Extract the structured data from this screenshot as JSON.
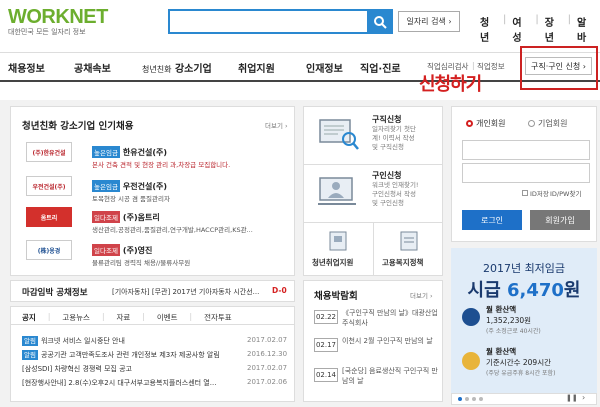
{
  "header": {
    "logo_text": "WORKNET",
    "logo_sub": "대한민국 모든 일자리 정보",
    "search_placeholder": "",
    "job_search_label": "일자리 검색",
    "top_links": [
      "청년",
      "여성",
      "장년",
      "알바"
    ]
  },
  "nav": {
    "items": [
      "채용정보",
      "공채속보",
      "청년친화",
      "강소기업",
      "취업지원",
      "인재정보",
      "직업·진로"
    ],
    "sub_items": [
      "직업심리검사",
      "직업정보"
    ],
    "apply_button": "구직·구인 신청"
  },
  "annotation": "신청하기",
  "companies_section": {
    "title": "청년친화 강소기업 인기채용",
    "more": "더보기",
    "items": [
      {
        "logo": "(주)한유건설",
        "tag": "높은임금",
        "tag_color": "#2a88d0",
        "name": "한유건설(주)",
        "desc": "본사 건축 견적 및 현장 관리 과,차장급 모집합니다."
      },
      {
        "logo": "우전건설(주)",
        "tag": "높은임금",
        "tag_color": "#2a88d0",
        "name": "우전건설(주)",
        "desc": "토목현장 시공 겸 품질관리자"
      },
      {
        "logo": "옴트리",
        "tag": "일다조제",
        "tag_color": "#d0434a",
        "name": "(주)옴트리",
        "desc": "생산관리,공정관리,품질관리,연구개발,HACCP관리,KS관..."
      },
      {
        "logo": "(株)옹경",
        "tag": "일다조제",
        "tag_color": "#d0434a",
        "name": "(주)영진",
        "desc": "물류관리팀 경력직 채용//물류사무원"
      }
    ]
  },
  "services": {
    "items": [
      {
        "title": "구직신청",
        "desc": "일자리찾기 첫단계! 이력서 작성 및 구직신청"
      },
      {
        "title": "구인신청",
        "desc": "워크넷 인재찾기! 구인신청서 작성 및 구인신청"
      }
    ],
    "bottom": [
      "청년취업지원",
      "고용복지정책"
    ]
  },
  "deadline": {
    "title": "마감임박 공채정보",
    "text": "[기아자동차] [무관] 2017년 기아자동차 시간선...",
    "dday": "D-0"
  },
  "notices": {
    "tabs": [
      "공지",
      "고용뉴스",
      "자료",
      "이벤트",
      "전자투표"
    ],
    "more": "더보기",
    "items": [
      {
        "badge": "알림",
        "text": "워크넷 서비스 일시중단 안내",
        "date": "2017.02.07"
      },
      {
        "badge": "알림",
        "text": "공공기관 고객만족도조사 관련 개인정보 제3자 제공사항 알림",
        "date": "2016.12.30"
      },
      {
        "badge": "",
        "text": "[삼성SDI] 차량혁신 경쟁력 모집 공고",
        "date": "2017.02.07"
      },
      {
        "badge": "",
        "text": "[현장행사안내] 2.8(수)오후2시 대구서부고용복지플러스센터 열...",
        "date": "2017.02.06"
      }
    ]
  },
  "fairs": {
    "title": "채용박람회",
    "more": "더보기",
    "items": [
      {
        "date": "02.22",
        "text": "《구인구직 만남의 날》대광산업 주식회사"
      },
      {
        "date": "02.17",
        "text": "이천시 2월 구인구직 만남의 날"
      },
      {
        "date": "02.14",
        "text": "[국순당] 음료생산직 구인구직 만남의 날"
      }
    ]
  },
  "login": {
    "member_personal": "개인회원",
    "member_company": "기업회원",
    "id_save": "ID저장",
    "find": "ID/PW찾기",
    "login_button": "로그인",
    "join_button": "회원가입"
  },
  "wage_banner": {
    "title": "2017년 최저임금",
    "amount_prefix": "시급",
    "amount_value": "6,470",
    "amount_unit": "원",
    "monthly_label": "월 환산액",
    "monthly_value": "1,352,230원",
    "monthly_note": "(주 소정근로 40시간)",
    "monthly2_label": "월 환산액",
    "monthly2_value": "기준시간수 209시간",
    "monthly2_note": "(주당 유급주휴 8시간 포함)"
  },
  "colors": {
    "accent": "#2a88d0",
    "highlight": "#d42020",
    "logo_green": "#6cae2e",
    "banner_bg": "#e0ecf8"
  }
}
